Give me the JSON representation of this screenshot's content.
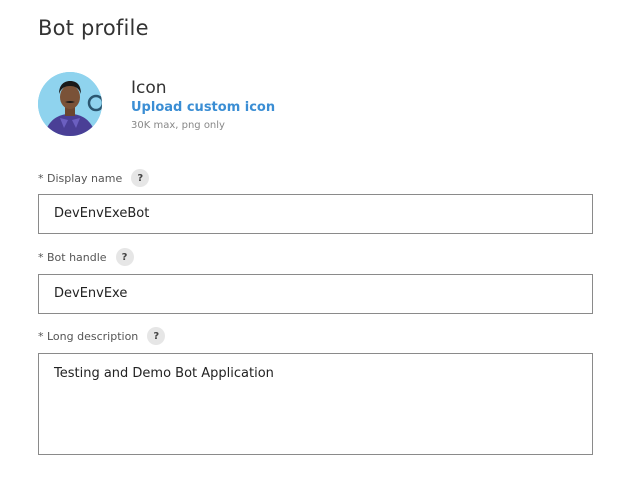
{
  "header": {
    "title": "Bot profile"
  },
  "icon_section": {
    "title": "Icon",
    "upload_link": "Upload custom icon",
    "hint": "30K max, png only"
  },
  "fields": {
    "display_name": {
      "label": "* Display name",
      "value": "DevEnvExeBot",
      "help": "?"
    },
    "bot_handle": {
      "label": "* Bot handle",
      "value": "DevEnvExe",
      "help": "?"
    },
    "long_description": {
      "label": "* Long description",
      "value": "Testing and Demo Bot Application",
      "help": "?"
    }
  }
}
